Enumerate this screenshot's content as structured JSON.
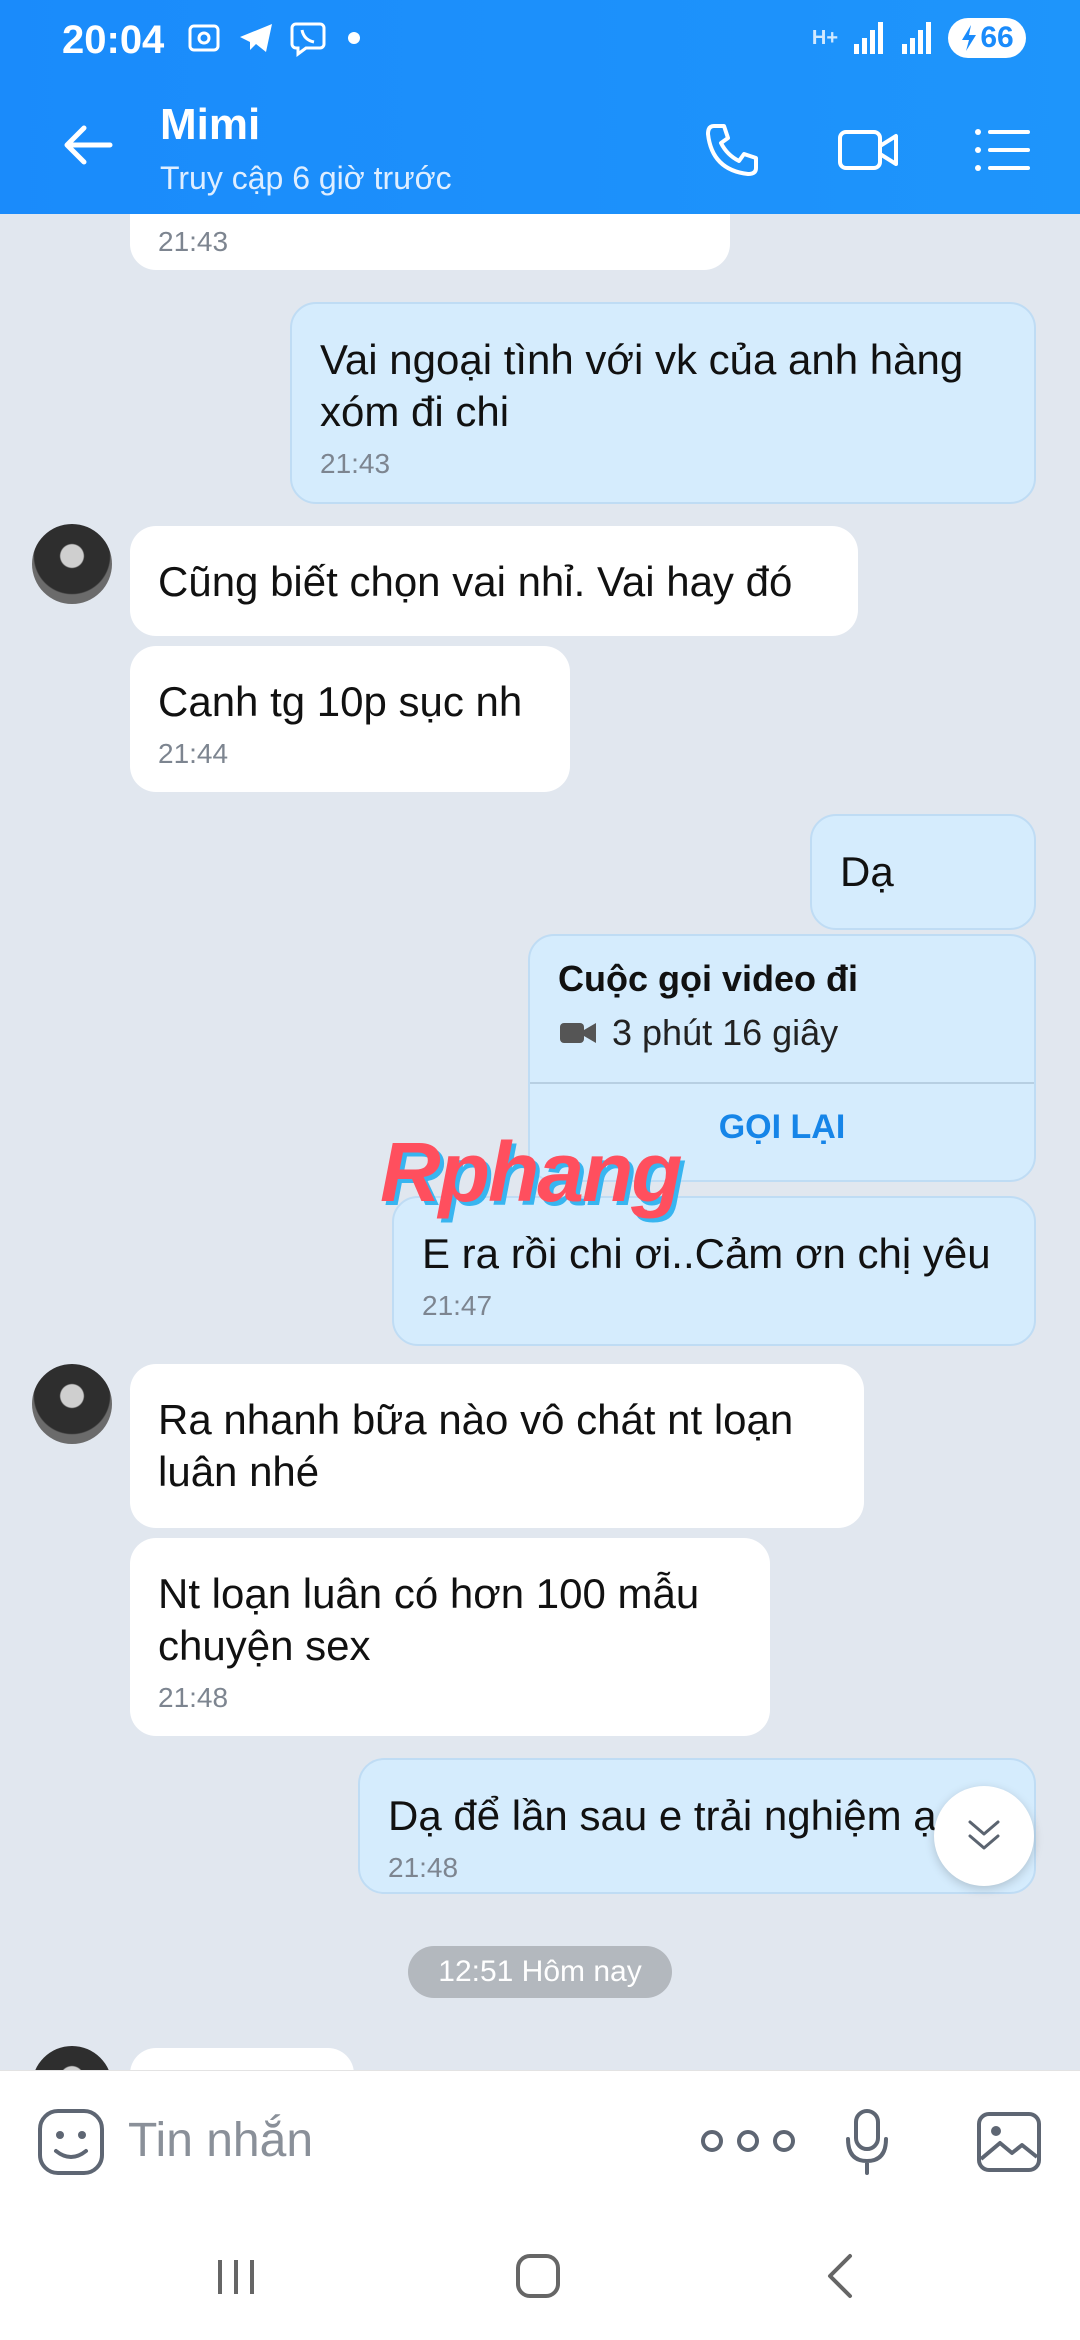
{
  "status_bar": {
    "time": "20:04",
    "network": "H+",
    "battery": "66"
  },
  "header": {
    "contact_name": "Mimi",
    "contact_status": "Truy cập 6 giờ trước"
  },
  "messages": [
    {
      "dir": "in",
      "text": "",
      "time": "21:43"
    },
    {
      "dir": "out",
      "text": "Vai ngoại tình với vk của anh hàng xóm đi chi",
      "time": "21:43"
    },
    {
      "dir": "in",
      "text": "Cũng biết chọn vai nhỉ. Vai hay đó",
      "time": ""
    },
    {
      "dir": "in",
      "text": "Canh tg 10p sục nh",
      "time": "21:44"
    },
    {
      "dir": "out",
      "text": "Dạ",
      "time": ""
    },
    {
      "dir": "out",
      "text": "E ra rồi chi ơi..Cảm ơn chị yêu",
      "time": "21:47"
    },
    {
      "dir": "in",
      "text": "Ra nhanh bữa nào vô chát nt loạn luân nhé",
      "time": ""
    },
    {
      "dir": "in",
      "text": "Nt loạn luân có hơn 100 mẫu chuyện sex",
      "time": "21:48"
    },
    {
      "dir": "out",
      "text": "Dạ để lần sau e trải nghiệm ạ",
      "time": "21:48"
    }
  ],
  "call_card": {
    "title": "Cuộc gọi video đi",
    "duration": "3 phút 16 giây",
    "action": "GỌI LẠI"
  },
  "watermark": "Rphang",
  "date_separator": "12:51 Hôm nay",
  "input": {
    "placeholder": "Tin nhắn"
  },
  "colors": {
    "header": "#1a8bfb",
    "outgoing_bubble": "#d5ecfd",
    "incoming_bubble": "#ffffff",
    "chat_bg": "#e1e7ef",
    "accent": "#1685e8"
  }
}
